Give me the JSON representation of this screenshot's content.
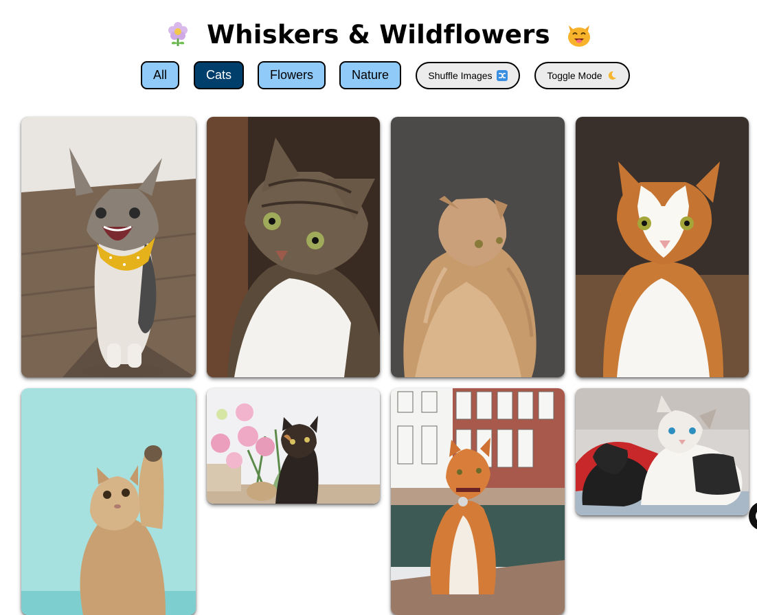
{
  "header": {
    "title": "Whiskers & Wildflowers",
    "left_icon": "flower-emoji-icon",
    "right_icon": "cat-face-emoji-icon"
  },
  "filters": {
    "all": "All",
    "cats": "Cats",
    "flowers": "Flowers",
    "nature": "Nature",
    "active": "Cats"
  },
  "actions": {
    "shuffle_label": "Shuffle Images",
    "shuffle_icon": "shuffle-icon",
    "toggle_label": "Toggle Mode",
    "toggle_icon": "moon-icon"
  },
  "colors": {
    "filter_button": "#90caf9",
    "filter_active": "#003f6b",
    "pill_button": "#ececec"
  },
  "gallery": [
    {
      "name": "cat-photo-laughing-tabby-with-bandana"
    },
    {
      "name": "cat-photo-tabby-closeup"
    },
    {
      "name": "cat-photo-fluffy-ginger-maine-coon"
    },
    {
      "name": "cat-photo-ginger-white-cat"
    },
    {
      "name": "cat-photo-kitten-reaching-paw"
    },
    {
      "name": "cat-photo-tortoiseshell-with-flowers"
    },
    {
      "name": "cat-photo-orange-cat-sitting-street"
    },
    {
      "name": "cat-photo-kittens-lying-together"
    }
  ]
}
